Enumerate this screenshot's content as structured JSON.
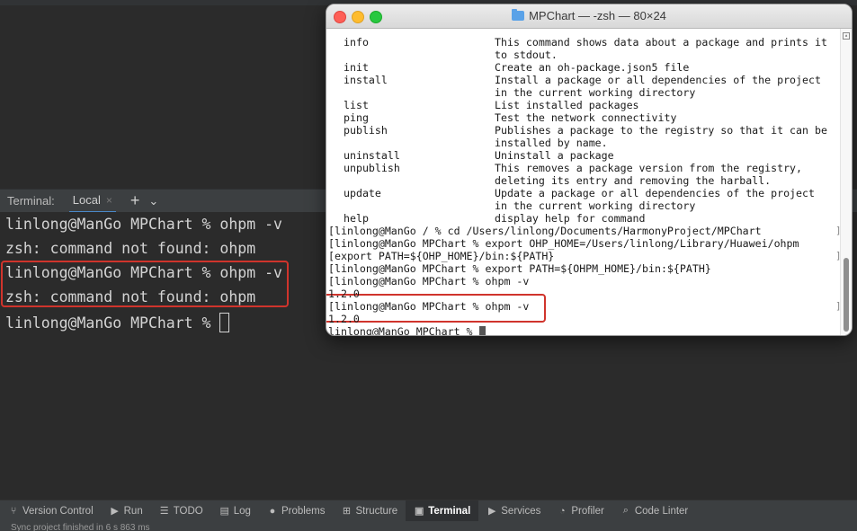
{
  "ide": {
    "terminal_header": {
      "label": "Terminal:",
      "tab_label": "Local",
      "close_glyph": "×",
      "add_glyph": "+",
      "dropdown_glyph": "⌄"
    },
    "terminal_lines": [
      "linlong@ManGo MPChart % ohpm -v",
      "zsh: command not found: ohpm",
      "linlong@ManGo MPChart % ohpm -v",
      "zsh: command not found: ohpm",
      "linlong@ManGo MPChart % "
    ],
    "toolbar": [
      {
        "icon": "version-control-icon",
        "glyph": "⑂",
        "label": "Version Control"
      },
      {
        "icon": "run-icon",
        "glyph": "▶",
        "label": "Run"
      },
      {
        "icon": "todo-icon",
        "glyph": "☰",
        "label": "TODO"
      },
      {
        "icon": "log-icon",
        "glyph": "▤",
        "label": "Log"
      },
      {
        "icon": "problems-icon",
        "glyph": "●",
        "label": "Problems"
      },
      {
        "icon": "structure-icon",
        "glyph": "⊞",
        "label": "Structure"
      },
      {
        "icon": "terminal-icon",
        "glyph": "▣",
        "label": "Terminal"
      },
      {
        "icon": "services-icon",
        "glyph": "▶",
        "label": "Services"
      },
      {
        "icon": "profiler-icon",
        "glyph": "◔",
        "label": "Profiler"
      },
      {
        "icon": "code-linter-icon",
        "glyph": "⌕",
        "label": "Code Linter"
      }
    ],
    "status_text": "Sync project finished in 6 s 863 ms"
  },
  "mac_window": {
    "title": "MPChart — -zsh — 80×24",
    "help_rows": [
      {
        "cmd": "info",
        "desc": "This command shows data about a package and prints it"
      },
      {
        "cmd": "",
        "desc": "to stdout."
      },
      {
        "cmd": "init",
        "desc": "Create an oh-package.json5 file"
      },
      {
        "cmd": "install",
        "desc": "Install a package or all dependencies of the project"
      },
      {
        "cmd": "",
        "desc": "in the current working directory"
      },
      {
        "cmd": "list",
        "desc": "List installed packages"
      },
      {
        "cmd": "ping",
        "desc": "Test the network connectivity"
      },
      {
        "cmd": "publish",
        "desc": "Publishes a package to the registry so that it can be"
      },
      {
        "cmd": "",
        "desc": "installed by name."
      },
      {
        "cmd": "uninstall",
        "desc": "Uninstall a package"
      },
      {
        "cmd": "unpublish",
        "desc": "This removes a package version from the registry,"
      },
      {
        "cmd": "",
        "desc": "deleting its entry and removing the harball."
      },
      {
        "cmd": "update",
        "desc": "Update a package or all dependencies of the project"
      },
      {
        "cmd": "",
        "desc": "in the current working directory"
      },
      {
        "cmd": "help",
        "desc": "display help for command"
      }
    ],
    "shell_lines": [
      "[linlong@ManGo / % cd /Users/linlong/Documents/HarmonyProject/MPChart",
      "[linlong@ManGo MPChart % export OHP_HOME=/Users/linlong/Library/Huawei/ohpm",
      "[export PATH=${OHP_HOME}/bin:${PATH}",
      "[linlong@ManGo MPChart % export PATH=${OHPM_HOME}/bin:${PATH}",
      "[linlong@ManGo MPChart % ohpm -v",
      "1.2.0",
      "[linlong@ManGo MPChart % ohpm -v",
      "1.2.0",
      "linlong@ManGo MPChart % "
    ],
    "bracket_glyph": "]"
  },
  "colors": {
    "highlight_border": "#d0342c",
    "ide_background": "#2b2b2b",
    "active_tab_underline": "#4a88c7"
  }
}
